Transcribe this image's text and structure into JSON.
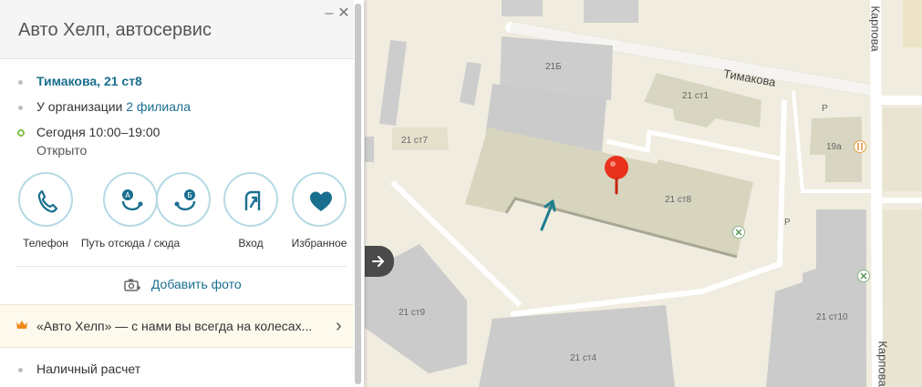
{
  "panel": {
    "title": "Авто Хелп, автосервис",
    "address": "Тимакова, 21 ст8",
    "branches_prefix": "У организации",
    "branches_link": "2 филиала",
    "hours": "Сегодня 10:00–19:00",
    "status": "Открыто",
    "actions": [
      {
        "label": "Телефон",
        "icon": "phone-icon"
      },
      {
        "label": "Путь отсюда / сюда",
        "icon": "route-icon"
      },
      {
        "label": "Вход",
        "icon": "entrance-icon"
      },
      {
        "label": "Избранное",
        "icon": "heart-icon"
      }
    ],
    "add_photo": "Добавить фото",
    "promo": "«Авто Хелп» — с нами вы всегда на колесах...",
    "payment": "Наличный расчет",
    "colors": {
      "accent": "#1a6f8f",
      "open": "#7dc24b",
      "promo_bg": "#fdf9ed"
    }
  },
  "map": {
    "streets": {
      "timakova": "Тимакова",
      "karpova_top": "Карпова",
      "karpova_bottom": "Карпова"
    },
    "buildings": {
      "b21b": "21Б",
      "b21st1": "21 ст1",
      "b19a": "19а",
      "b21st7": "21 ст7",
      "b21st8": "21 ст8",
      "b21st9": "21 ст9",
      "b21st4": "21 ст4",
      "b21st10": "21 ст10"
    },
    "parking": "P",
    "colors": {
      "marker": "#e8321b",
      "arrow": "#1f7e8e"
    }
  }
}
